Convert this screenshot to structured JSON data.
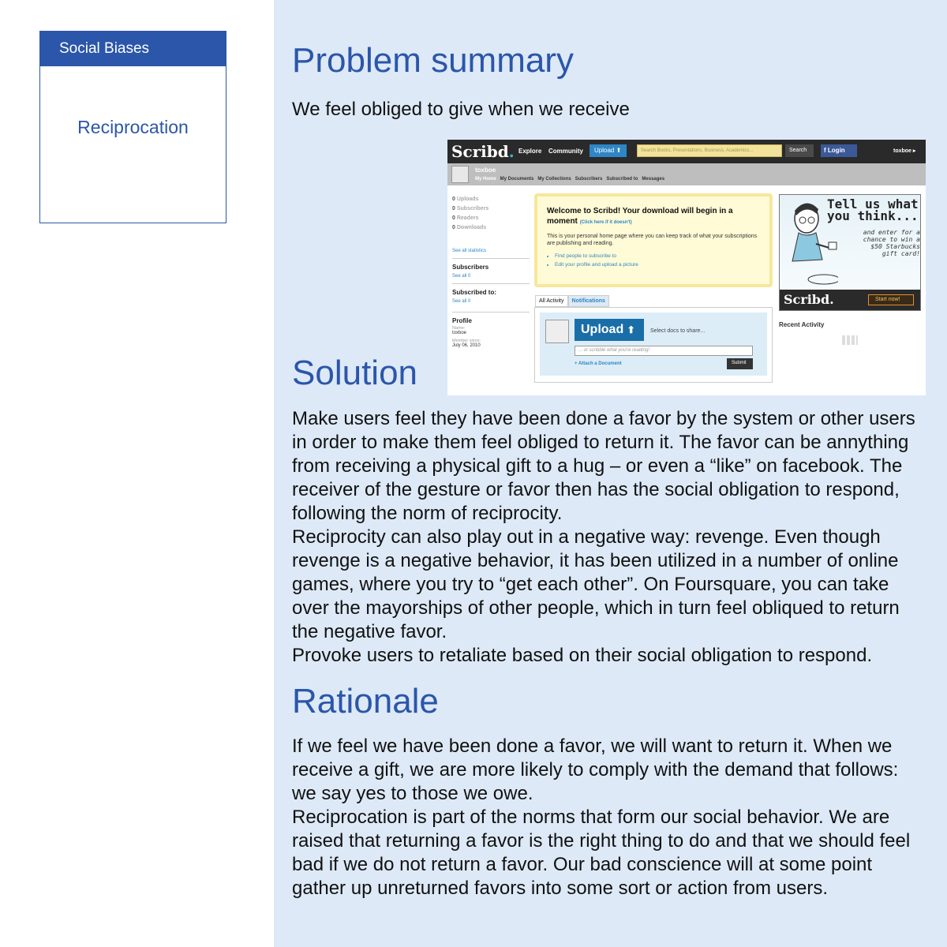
{
  "sidebar": {
    "header": "Social Biases",
    "item": "Reciprocation"
  },
  "sections": {
    "problem": {
      "heading": "Problem summary",
      "text": "We feel obliged to give when we receive"
    },
    "solution": {
      "heading": "Solution",
      "paragraphs": [
        "Make users feel they have been done a favor by the system or other users in order to make them feel obliged to return it. The favor can be annything from receiving a physical gift to a hug – or even a “like” on facebook. The receiver of the gesture or favor then has the social obligation to respond, following the norm of reciprocity.",
        "Reciprocity can also play out in a negative way: revenge. Even though revenge is a negative behavior, it has been utilized in a number of online games, where you try to “get each other”. On Foursquare, you can take over the mayorships of other people, which in turn feel obliqued to return the negative favor.",
        "Provoke users to retaliate based on their social obligation to respond."
      ]
    },
    "rationale": {
      "heading": "Rationale",
      "paragraphs": [
        "If we feel we have been done a favor, we will want to return it. When we receive a gift, we are more likely to comply with the demand that follows: we say yes to those we owe.",
        "Reciprocation is part of the norms that form our social behavior. We are raised that returning a favor is the right thing to do and that we should feel bad if we do not return a favor. Our bad conscience will at some point gather up unreturned favors into some sort or action from users."
      ]
    }
  },
  "screenshot": {
    "logo": "Scribd",
    "logo_dot": ".",
    "nav": [
      "Explore",
      "Community"
    ],
    "upload": "Upload",
    "search_placeholder": "Search Books, Presentations, Business, Academics...",
    "search_button": "Search",
    "facebook_login": "Login",
    "user": "toxboe",
    "user_menu": "toxboe ▸",
    "subnav": [
      "My Home",
      "My Documents",
      "My Collections",
      "Subscribers",
      "Subscribed to",
      "Messages"
    ],
    "stats": [
      {
        "count": "0",
        "label": "Uploads"
      },
      {
        "count": "0",
        "label": "Subscribers"
      },
      {
        "count": "0",
        "label": "Readers"
      },
      {
        "count": "0",
        "label": "Downloads"
      }
    ],
    "see_all_statistics": "See all statistics",
    "subscribers_title": "Subscribers",
    "subscribers_see_all": "See all 0",
    "subscribed_title": "Subscribed to:",
    "subscribed_see_all": "See all 0",
    "profile_title": "Profile",
    "name_label": "Name:",
    "name_value": "toxboe",
    "member_label": "Member since:",
    "member_value": "July 06, 2010",
    "welcome_title": "Welcome to Scribd! Your download will begin in a moment",
    "welcome_link": "(Click here if it doesn't)",
    "welcome_text": "This is your personal home page where you can keep track of what your subscriptions are publishing and reading.",
    "welcome_links": [
      "Find people to subscribe to",
      "Edit your profile and upload a picture"
    ],
    "tab_all": "All Activity",
    "tab_notifications": "Notifications",
    "big_upload": "Upload",
    "select_docs": "Select docs to share...",
    "scribble_placeholder": "... or scribble what you're reading!",
    "attach": "+ Attach a Document",
    "submit": "Submit",
    "ad_title": "Tell us what you think...",
    "ad_sub": "and enter for a chance to win a $50 Starbucks gift card!",
    "ad_logo": "Scribd.",
    "ad_button": "Start now!",
    "recent_activity": "Recent Activity"
  }
}
